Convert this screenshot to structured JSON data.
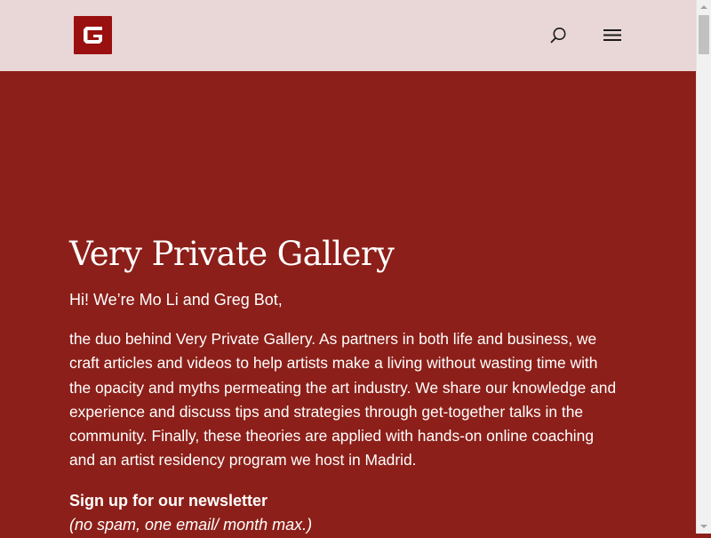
{
  "header": {
    "logo_letter": "G",
    "logo_icon": "gallery-logo-icon",
    "search_icon": "search-icon",
    "menu_icon": "hamburger-menu-icon",
    "background_color": "#e9d6d6",
    "logo_color": "#9a0f0f"
  },
  "main": {
    "background_color": "#8c1f19",
    "title": "Very Private Gallery",
    "greeting": "Hi! We’re Mo Li and Greg Bot,",
    "body": "the duo behind Very Private Gallery. As partners in both life and business, we craft articles and videos to help artists make a living without wasting time with the opacity and myths permeating the art industry. We share our knowledge and experience and discuss tips and strategies through get-together talks in the community. Finally, these theories are applied with hands-on online coaching and an artist residency program we host in Madrid.",
    "newsletter_heading": "Sign up for our newsletter",
    "newsletter_note": "(no spam, one email/ month max.)"
  }
}
